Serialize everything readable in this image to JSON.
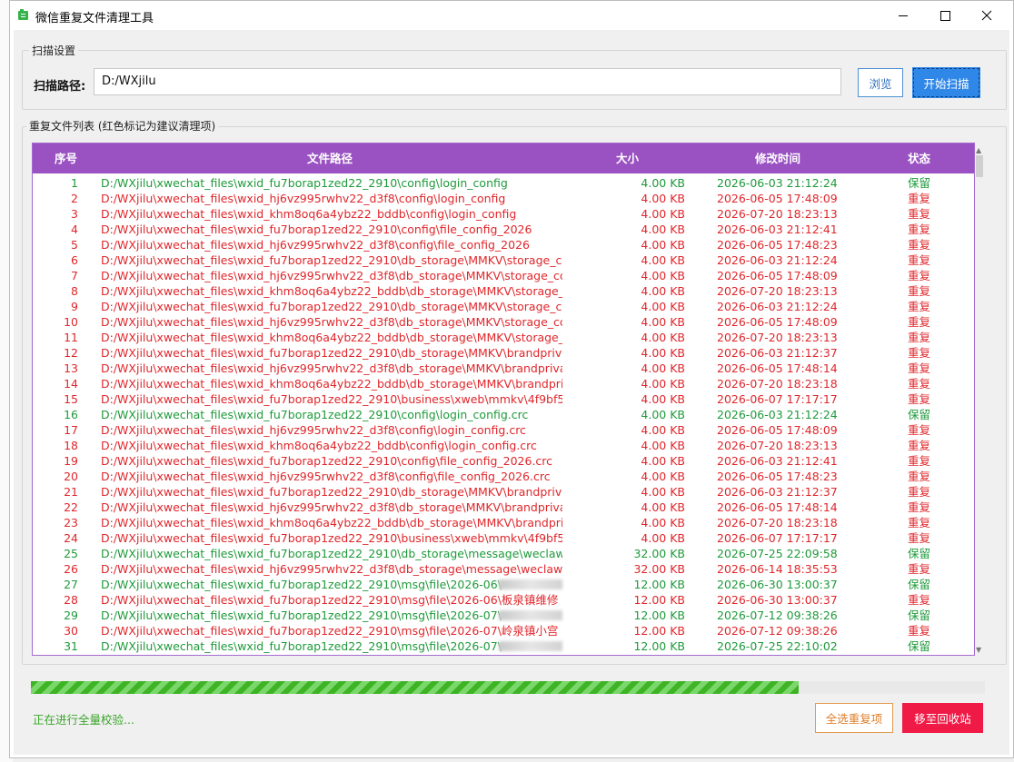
{
  "window": {
    "title": "微信重复文件清理工具"
  },
  "scan": {
    "group_title": "扫描设置",
    "path_label": "扫描路径:",
    "path_value": "D:/WXjilu",
    "browse_label": "浏览",
    "start_label": "开始扫描"
  },
  "list": {
    "group_title": "重复文件列表 (红色标记为建议清理项)",
    "columns": {
      "no": "序号",
      "path": "文件路径",
      "size": "大小",
      "time": "修改时间",
      "state": "状态"
    },
    "rows": [
      {
        "no": "1",
        "path": "D:/WXjilu\\xwechat_files\\wxid_fu7borap1zed22_2910\\config\\login_config",
        "size": "4.00 KB",
        "time": "2026-06-03 21:12:24",
        "state": "保留",
        "keep": true
      },
      {
        "no": "2",
        "path": "D:/WXjilu\\xwechat_files\\wxid_hj6vz995rwhv22_d3f8\\config\\login_config",
        "size": "4.00 KB",
        "time": "2026-06-05 17:48:09",
        "state": "重复",
        "keep": false
      },
      {
        "no": "3",
        "path": "D:/WXjilu\\xwechat_files\\wxid_khm8oq6a4ybz22_bddb\\config\\login_config",
        "size": "4.00 KB",
        "time": "2026-07-20 18:23:13",
        "state": "重复",
        "keep": false
      },
      {
        "no": "4",
        "path": "D:/WXjilu\\xwechat_files\\wxid_fu7borap1zed22_2910\\config\\file_config_2026",
        "size": "4.00 KB",
        "time": "2026-06-03 21:12:41",
        "state": "重复",
        "keep": false
      },
      {
        "no": "5",
        "path": "D:/WXjilu\\xwechat_files\\wxid_hj6vz995rwhv22_d3f8\\config\\file_config_2026",
        "size": "4.00 KB",
        "time": "2026-06-05 17:48:23",
        "state": "重复",
        "keep": false
      },
      {
        "no": "6",
        "path": "D:/WXjilu\\xwechat_files\\wxid_fu7borap1zed22_2910\\db_storage\\MMKV\\storage_c",
        "size": "4.00 KB",
        "time": "2026-06-03 21:12:24",
        "state": "重复",
        "keep": false
      },
      {
        "no": "7",
        "path": "D:/WXjilu\\xwechat_files\\wxid_hj6vz995rwhv22_d3f8\\db_storage\\MMKV\\storage_cc",
        "size": "4.00 KB",
        "time": "2026-06-05 17:48:09",
        "state": "重复",
        "keep": false
      },
      {
        "no": "8",
        "path": "D:/WXjilu\\xwechat_files\\wxid_khm8oq6a4ybz22_bddb\\db_storage\\MMKV\\storage_",
        "size": "4.00 KB",
        "time": "2026-07-20 18:23:13",
        "state": "重复",
        "keep": false
      },
      {
        "no": "9",
        "path": "D:/WXjilu\\xwechat_files\\wxid_fu7borap1zed22_2910\\db_storage\\MMKV\\storage_c",
        "size": "4.00 KB",
        "time": "2026-06-03 21:12:24",
        "state": "重复",
        "keep": false
      },
      {
        "no": "10",
        "path": "D:/WXjilu\\xwechat_files\\wxid_hj6vz995rwhv22_d3f8\\db_storage\\MMKV\\storage_cc",
        "size": "4.00 KB",
        "time": "2026-06-05 17:48:09",
        "state": "重复",
        "keep": false
      },
      {
        "no": "11",
        "path": "D:/WXjilu\\xwechat_files\\wxid_khm8oq6a4ybz22_bddb\\db_storage\\MMKV\\storage_",
        "size": "4.00 KB",
        "time": "2026-07-20 18:23:13",
        "state": "重复",
        "keep": false
      },
      {
        "no": "12",
        "path": "D:/WXjilu\\xwechat_files\\wxid_fu7borap1zed22_2910\\db_storage\\MMKV\\brandpriv",
        "size": "4.00 KB",
        "time": "2026-06-03 21:12:37",
        "state": "重复",
        "keep": false
      },
      {
        "no": "13",
        "path": "D:/WXjilu\\xwechat_files\\wxid_hj6vz995rwhv22_d3f8\\db_storage\\MMKV\\brandpriva",
        "size": "4.00 KB",
        "time": "2026-06-05 17:48:14",
        "state": "重复",
        "keep": false
      },
      {
        "no": "14",
        "path": "D:/WXjilu\\xwechat_files\\wxid_khm8oq6a4ybz22_bddb\\db_storage\\MMKV\\brandpri",
        "size": "4.00 KB",
        "time": "2026-07-20 18:23:18",
        "state": "重复",
        "keep": false
      },
      {
        "no": "15",
        "path": "D:/WXjilu\\xwechat_files\\wxid_fu7borap1zed22_2910\\business\\xweb\\mmkv\\4f9bf5",
        "size": "4.00 KB",
        "time": "2026-06-07 17:17:17",
        "state": "重复",
        "keep": false
      },
      {
        "no": "16",
        "path": "D:/WXjilu\\xwechat_files\\wxid_fu7borap1zed22_2910\\config\\login_config.crc",
        "size": "4.00 KB",
        "time": "2026-06-03 21:12:24",
        "state": "保留",
        "keep": true
      },
      {
        "no": "17",
        "path": "D:/WXjilu\\xwechat_files\\wxid_hj6vz995rwhv22_d3f8\\config\\login_config.crc",
        "size": "4.00 KB",
        "time": "2026-06-05 17:48:09",
        "state": "重复",
        "keep": false
      },
      {
        "no": "18",
        "path": "D:/WXjilu\\xwechat_files\\wxid_khm8oq6a4ybz22_bddb\\config\\login_config.crc",
        "size": "4.00 KB",
        "time": "2026-07-20 18:23:13",
        "state": "重复",
        "keep": false
      },
      {
        "no": "19",
        "path": "D:/WXjilu\\xwechat_files\\wxid_fu7borap1zed22_2910\\config\\file_config_2026.crc",
        "size": "4.00 KB",
        "time": "2026-06-03 21:12:41",
        "state": "重复",
        "keep": false
      },
      {
        "no": "20",
        "path": "D:/WXjilu\\xwechat_files\\wxid_hj6vz995rwhv22_d3f8\\config\\file_config_2026.crc",
        "size": "4.00 KB",
        "time": "2026-06-05 17:48:23",
        "state": "重复",
        "keep": false
      },
      {
        "no": "21",
        "path": "D:/WXjilu\\xwechat_files\\wxid_fu7borap1zed22_2910\\db_storage\\MMKV\\brandpriv",
        "size": "4.00 KB",
        "time": "2026-06-03 21:12:37",
        "state": "重复",
        "keep": false
      },
      {
        "no": "22",
        "path": "D:/WXjilu\\xwechat_files\\wxid_hj6vz995rwhv22_d3f8\\db_storage\\MMKV\\brandpriva",
        "size": "4.00 KB",
        "time": "2026-06-05 17:48:14",
        "state": "重复",
        "keep": false
      },
      {
        "no": "23",
        "path": "D:/WXjilu\\xwechat_files\\wxid_khm8oq6a4ybz22_bddb\\db_storage\\MMKV\\brandpri",
        "size": "4.00 KB",
        "time": "2026-07-20 18:23:18",
        "state": "重复",
        "keep": false
      },
      {
        "no": "24",
        "path": "D:/WXjilu\\xwechat_files\\wxid_fu7borap1zed22_2910\\business\\xweb\\mmkv\\4f9bf5",
        "size": "4.00 KB",
        "time": "2026-06-07 17:17:17",
        "state": "重复",
        "keep": false
      },
      {
        "no": "25",
        "path": "D:/WXjilu\\xwechat_files\\wxid_fu7borap1zed22_2910\\db_storage\\message\\weclaw.c",
        "size": "32.00 KB",
        "time": "2026-07-25 22:09:58",
        "state": "保留",
        "keep": true
      },
      {
        "no": "26",
        "path": "D:/WXjilu\\xwechat_files\\wxid_hj6vz995rwhv22_d3f8\\db_storage\\message\\weclaw.c",
        "size": "32.00 KB",
        "time": "2026-06-14 18:35:53",
        "state": "重复",
        "keep": false
      },
      {
        "no": "27",
        "path": "D:/WXjilu\\xwechat_files\\wxid_fu7borap1zed22_2910\\msg\\file\\2026-06\\",
        "size": "12.00 KB",
        "time": "2026-06-30 13:00:37",
        "state": "保留",
        "keep": true,
        "blur": true
      },
      {
        "no": "28",
        "path": "D:/WXjilu\\xwechat_files\\wxid_fu7borap1zed22_2910\\msg\\file\\2026-06\\板泉镇维修",
        "size": "12.00 KB",
        "time": "2026-06-30 13:00:37",
        "state": "重复",
        "keep": false
      },
      {
        "no": "29",
        "path": "D:/WXjilu\\xwechat_files\\wxid_fu7borap1zed22_2910\\msg\\file\\2026-07\\",
        "size": "12.00 KB",
        "time": "2026-07-12 09:38:26",
        "state": "保留",
        "keep": true,
        "blur": true
      },
      {
        "no": "30",
        "path": "D:/WXjilu\\xwechat_files\\wxid_fu7borap1zed22_2910\\msg\\file\\2026-07\\岭泉镇小宫",
        "size": "12.00 KB",
        "time": "2026-07-12 09:38:26",
        "state": "重复",
        "keep": false
      },
      {
        "no": "31",
        "path": "D:/WXjilu\\xwechat_files\\wxid_fu7borap1zed22_2910\\msg\\file\\2026-07\\",
        "size": "12.00 KB",
        "time": "2026-07-25 22:10:02",
        "state": "保留",
        "keep": true,
        "blur": true
      }
    ]
  },
  "progress": {
    "fraction": 0.805
  },
  "footer": {
    "status_text": "正在进行全量校验...",
    "select_duplicates_label": "全选重复项",
    "move_to_recycle_label": "移至回收站"
  },
  "colors": {
    "keep": "#1e9a3a",
    "duplicate": "#e0262b",
    "header": "#9a52c2",
    "primary": "#2f87e8",
    "danger": "#ef1a45",
    "warning": "#e07e2a",
    "progress": "#3fb326"
  }
}
